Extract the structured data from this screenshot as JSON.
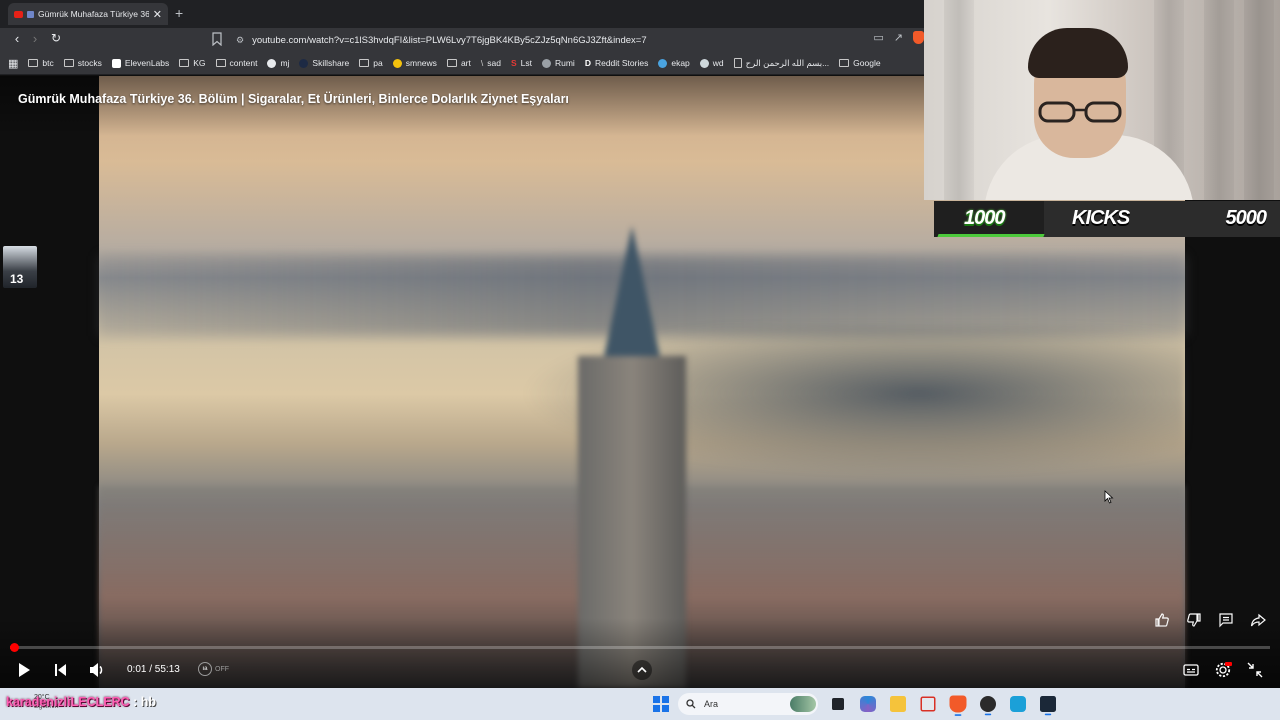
{
  "browser": {
    "tab": {
      "title": "Gümrük Muhafaza Türkiye 36",
      "close": "✕"
    },
    "new_tab": "+",
    "url": "youtube.com/watch?v=c1lS3hvdqFI&list=PLW6Lvy7T6jgBK4KBy5cZJz5qNn6GJ3Zft&index=7",
    "bookmarks": [
      {
        "label": "btc",
        "icon": "folder-icon"
      },
      {
        "label": "stocks",
        "icon": "folder-icon"
      },
      {
        "label": "ElevenLabs",
        "icon": "elevenlabs-icon"
      },
      {
        "label": "KG",
        "icon": "folder-icon"
      },
      {
        "label": "content",
        "icon": "folder-icon"
      },
      {
        "label": "mj",
        "icon": "github-icon"
      },
      {
        "label": "Skillshare",
        "icon": "skillshare-icon"
      },
      {
        "label": "pa",
        "icon": "folder-icon"
      },
      {
        "label": "smnews",
        "icon": "smiley-icon"
      },
      {
        "label": "art",
        "icon": "folder-icon"
      },
      {
        "label": "sad",
        "icon": "slash-icon"
      },
      {
        "label": "Lst",
        "icon": "s-logo-icon"
      },
      {
        "label": "Rumi",
        "icon": "globe-icon"
      },
      {
        "label": "Reddit Stories",
        "icon": "d-logo-icon"
      },
      {
        "label": "ekap",
        "icon": "bird-icon"
      },
      {
        "label": "wd",
        "icon": "wiki-icon"
      },
      {
        "label": "بسم الله الرحمن الرح...",
        "icon": "page-icon"
      },
      {
        "label": "Google",
        "icon": "folder-icon"
      }
    ]
  },
  "video": {
    "title": "Gümrük Muhafaza Türkiye 36. Bölüm | Sigaralar, Et Ürünleri, Binlerce Dolarlık Ziynet Eşyaları",
    "channel_avatar_text": "13",
    "time": "0:01 / 55:13",
    "progress": 0.0003,
    "autoplay": {
      "toggle": "ıa",
      "state": "OFF"
    }
  },
  "stream_overlay": {
    "goal_low": "1000",
    "goal_label": "KICKS",
    "goal_high": "5000"
  },
  "taskbar": {
    "weather_temp": "20°C",
    "weather_desc": "Eğilimin",
    "streamer_name": "karadenizliLECLERC",
    "streamer_msg": ": hb",
    "search_placeholder": "Ara"
  },
  "colors": {
    "accent_red": "#ff0000",
    "kick_green": "#4cc93b",
    "streamer_pink": "#ff5fb4",
    "windows_blue": "#1a73e8"
  }
}
